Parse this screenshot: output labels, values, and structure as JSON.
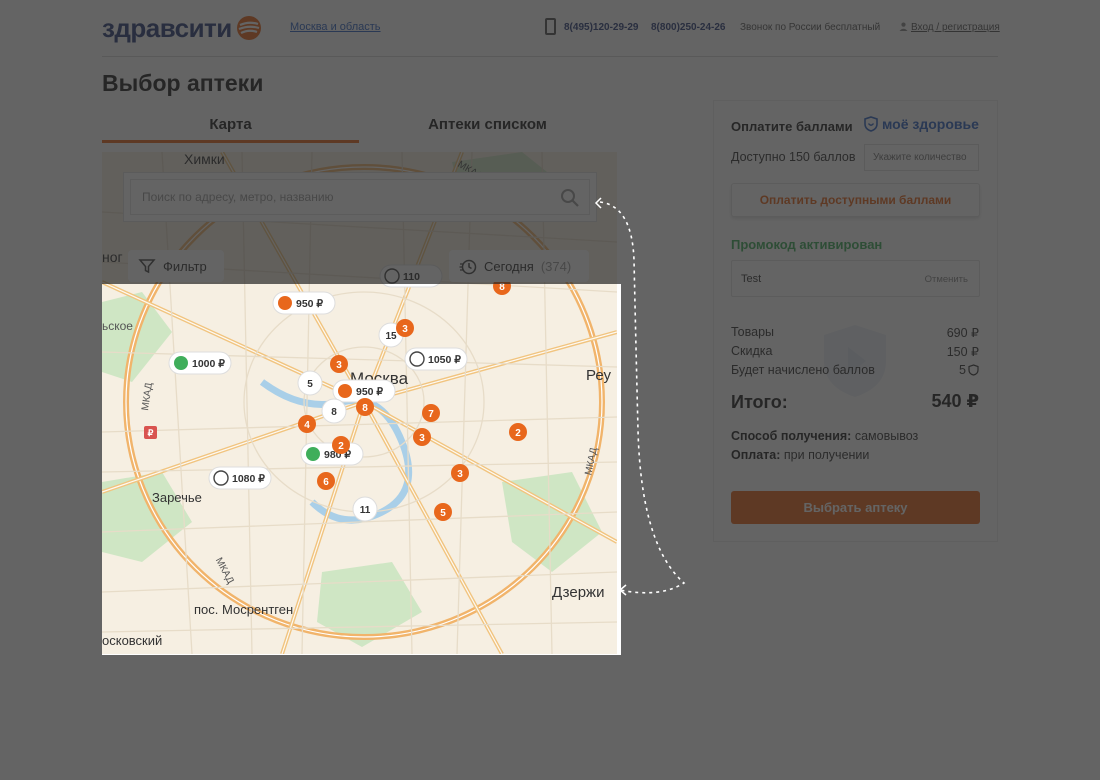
{
  "header": {
    "logo_text": "здравсити",
    "region": "Москва и область",
    "phone1": "8(495)120-29-29",
    "phone2": "8(800)250-24-26",
    "free_call": "Звонок по России бесплатный",
    "login": "Вход / регистрация"
  },
  "page": {
    "title": "Выбор аптеки"
  },
  "tabs": [
    {
      "label": "Карта",
      "active": true
    },
    {
      "label": "Аптеки списком",
      "active": false
    }
  ],
  "map": {
    "search_placeholder": "Поиск по адресу, метро, названию",
    "filter_label": "Фильтр",
    "today_label": "Сегодня",
    "today_count": "(374)",
    "labels": [
      "Химки",
      "МКАД",
      "Москва",
      "Реу",
      "Заречье",
      "Дзержи",
      "пос. Мосрентген",
      "осковский",
      "ьское",
      "ног",
      "МКАД",
      "МКАД",
      "МКАД"
    ],
    "markers": [
      {
        "kind": "brand",
        "value": "950 ₽"
      },
      {
        "kind": "flower",
        "value": "1000 ₽"
      },
      {
        "kind": "clock",
        "value": "1050 ₽"
      },
      {
        "kind": "brand",
        "value": "950 ₽"
      },
      {
        "kind": "flower",
        "value": "980 ₽"
      },
      {
        "kind": "clock",
        "value": "1080 ₽"
      },
      {
        "kind": "clock",
        "value": "110"
      },
      {
        "kind": "orange",
        "value": "8"
      },
      {
        "kind": "orange",
        "value": "3"
      },
      {
        "kind": "white",
        "value": "15"
      },
      {
        "kind": "orange",
        "value": "3"
      },
      {
        "kind": "white",
        "value": "5"
      },
      {
        "kind": "white",
        "value": "8"
      },
      {
        "kind": "orange",
        "value": "8"
      },
      {
        "kind": "orange",
        "value": "7"
      },
      {
        "kind": "orange",
        "value": "4"
      },
      {
        "kind": "orange",
        "value": "2"
      },
      {
        "kind": "orange",
        "value": "3"
      },
      {
        "kind": "orange",
        "value": "2"
      },
      {
        "kind": "orange",
        "value": "6"
      },
      {
        "kind": "orange",
        "value": "3"
      },
      {
        "kind": "white",
        "value": "11"
      },
      {
        "kind": "orange",
        "value": "5"
      }
    ]
  },
  "summary": {
    "pay_points_title": "Оплатите баллами",
    "partner_logo": "моё здоровье",
    "available_points": "Доступно 150 баллов",
    "qty_placeholder": "Укажите количество",
    "pay_points_button": "Оплатить доступными баллами",
    "promo_status": "Промокод активирован",
    "promo_code": "Test",
    "promo_cancel": "Отменить",
    "lines": [
      {
        "label": "Товары",
        "value": "690 ₽"
      },
      {
        "label": "Скидка",
        "value": "150 ₽"
      },
      {
        "label": "Будет начислено баллов",
        "value": "5"
      }
    ],
    "total_label": "Итого:",
    "total_value": "540 ₽",
    "pickup_label": "Способ получения:",
    "pickup_value": "самовывоз",
    "payment_label": "Оплата:",
    "payment_value": "при получении",
    "cta": "Выбрать аптеку"
  },
  "colors": {
    "accent": "#e8671c",
    "brand_blue": "#2b3f7a",
    "link": "#2f64c4",
    "success": "#3fae5b"
  }
}
